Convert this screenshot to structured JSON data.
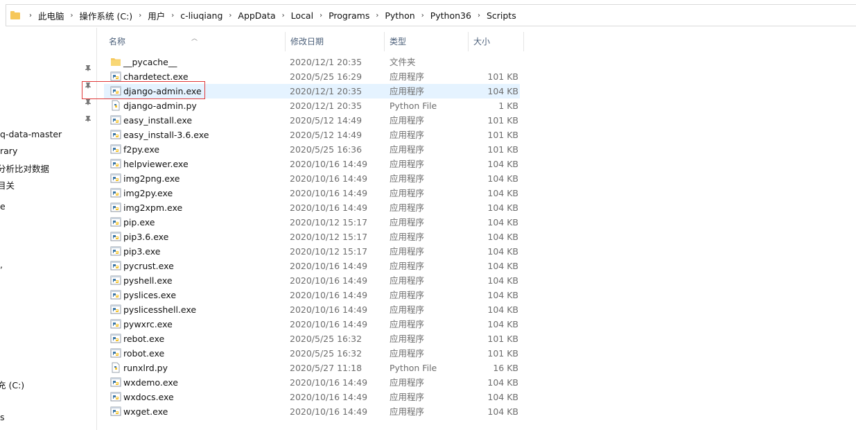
{
  "breadcrumbs": [
    "此电脑",
    "操作系统 (C:)",
    "用户",
    "c-liuqiang",
    "AppData",
    "Local",
    "Programs",
    "Python",
    "Python36",
    "Scripts"
  ],
  "nav": {
    "items": [
      "q-data-master",
      "rary",
      "分析比对数据",
      "目关",
      "e",
      ",",
      "充 (C:)",
      "s"
    ]
  },
  "columns": {
    "name": "名称",
    "date": "修改日期",
    "type": "类型",
    "size": "大小"
  },
  "files": [
    {
      "name": "__pycache__",
      "date": "2020/12/1 20:35",
      "type": "文件夹",
      "size": "",
      "icon": "folder-icon"
    },
    {
      "name": "chardetect.exe",
      "date": "2020/5/25 16:29",
      "type": "应用程序",
      "size": "101 KB",
      "icon": "python-exe-icon"
    },
    {
      "name": "django-admin.exe",
      "date": "2020/12/1 20:35",
      "type": "应用程序",
      "size": "104 KB",
      "icon": "python-exe-icon",
      "selected": true
    },
    {
      "name": "django-admin.py",
      "date": "2020/12/1 20:35",
      "type": "Python File",
      "size": "1 KB",
      "icon": "python-file-icon"
    },
    {
      "name": "easy_install.exe",
      "date": "2020/5/12 14:49",
      "type": "应用程序",
      "size": "101 KB",
      "icon": "python-exe-icon"
    },
    {
      "name": "easy_install-3.6.exe",
      "date": "2020/5/12 14:49",
      "type": "应用程序",
      "size": "101 KB",
      "icon": "python-exe-icon"
    },
    {
      "name": "f2py.exe",
      "date": "2020/5/25 16:36",
      "type": "应用程序",
      "size": "101 KB",
      "icon": "python-exe-icon"
    },
    {
      "name": "helpviewer.exe",
      "date": "2020/10/16 14:49",
      "type": "应用程序",
      "size": "104 KB",
      "icon": "python-exe-icon"
    },
    {
      "name": "img2png.exe",
      "date": "2020/10/16 14:49",
      "type": "应用程序",
      "size": "104 KB",
      "icon": "python-exe-icon"
    },
    {
      "name": "img2py.exe",
      "date": "2020/10/16 14:49",
      "type": "应用程序",
      "size": "104 KB",
      "icon": "python-exe-icon"
    },
    {
      "name": "img2xpm.exe",
      "date": "2020/10/16 14:49",
      "type": "应用程序",
      "size": "104 KB",
      "icon": "python-exe-icon"
    },
    {
      "name": "pip.exe",
      "date": "2020/10/12 15:17",
      "type": "应用程序",
      "size": "104 KB",
      "icon": "python-exe-icon"
    },
    {
      "name": "pip3.6.exe",
      "date": "2020/10/12 15:17",
      "type": "应用程序",
      "size": "104 KB",
      "icon": "python-exe-icon"
    },
    {
      "name": "pip3.exe",
      "date": "2020/10/12 15:17",
      "type": "应用程序",
      "size": "104 KB",
      "icon": "python-exe-icon"
    },
    {
      "name": "pycrust.exe",
      "date": "2020/10/16 14:49",
      "type": "应用程序",
      "size": "104 KB",
      "icon": "python-exe-icon"
    },
    {
      "name": "pyshell.exe",
      "date": "2020/10/16 14:49",
      "type": "应用程序",
      "size": "104 KB",
      "icon": "python-exe-icon"
    },
    {
      "name": "pyslices.exe",
      "date": "2020/10/16 14:49",
      "type": "应用程序",
      "size": "104 KB",
      "icon": "python-exe-icon"
    },
    {
      "name": "pyslicesshell.exe",
      "date": "2020/10/16 14:49",
      "type": "应用程序",
      "size": "104 KB",
      "icon": "python-exe-icon"
    },
    {
      "name": "pywxrc.exe",
      "date": "2020/10/16 14:49",
      "type": "应用程序",
      "size": "104 KB",
      "icon": "python-exe-icon"
    },
    {
      "name": "rebot.exe",
      "date": "2020/5/25 16:32",
      "type": "应用程序",
      "size": "101 KB",
      "icon": "python-exe-icon"
    },
    {
      "name": "robot.exe",
      "date": "2020/5/25 16:32",
      "type": "应用程序",
      "size": "101 KB",
      "icon": "python-exe-icon"
    },
    {
      "name": "runxlrd.py",
      "date": "2020/5/27 11:18",
      "type": "Python File",
      "size": "16 KB",
      "icon": "python-file-icon"
    },
    {
      "name": "wxdemo.exe",
      "date": "2020/10/16 14:49",
      "type": "应用程序",
      "size": "104 KB",
      "icon": "python-exe-icon"
    },
    {
      "name": "wxdocs.exe",
      "date": "2020/10/16 14:49",
      "type": "应用程序",
      "size": "104 KB",
      "icon": "python-exe-icon"
    },
    {
      "name": "wxget.exe",
      "date": "2020/10/16 14:49",
      "type": "应用程序",
      "size": "104 KB",
      "icon": "python-exe-icon"
    }
  ],
  "colors": {
    "selection": "#e5f3ff",
    "highlight_border": "#e03a3a",
    "folder": "#f6c75a",
    "header_text": "#4c607a"
  }
}
